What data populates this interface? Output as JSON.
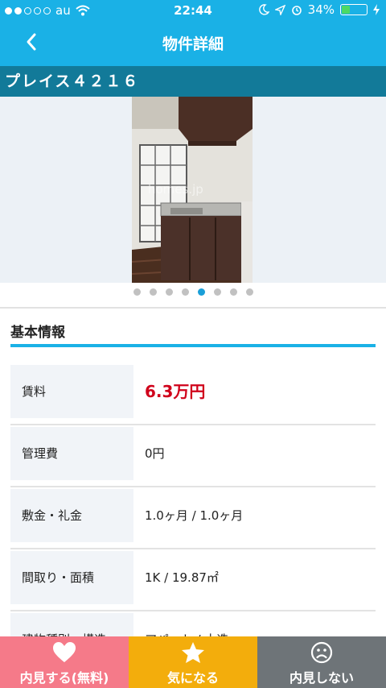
{
  "status_bar": {
    "carrier": "au",
    "time": "22:44",
    "battery": "34%",
    "battery_level": 0.34
  },
  "header": {
    "title": "物件詳細"
  },
  "property": {
    "name": "プレイス４２１６"
  },
  "gallery": {
    "watermark": "homes.jp",
    "page_count": 8,
    "active_index": 4
  },
  "section": {
    "title": "基本情報"
  },
  "details": [
    {
      "label": "賃料",
      "value": "6.3万円"
    },
    {
      "label": "管理費",
      "value": "0円"
    },
    {
      "label": "敷金・礼金",
      "value": "1.0ヶ月 / 1.0ヶ月"
    },
    {
      "label": "間取り・面積",
      "value": "1K / 19.87㎡"
    },
    {
      "label": "建物種別・構造",
      "value": "アパート / 木造"
    }
  ],
  "bottom_bar": {
    "visit": "内見する(無料)",
    "favorite": "気になる",
    "no_visit": "内見しない"
  },
  "colors": {
    "header": "#1ab1e6",
    "name_bar": "#127a99",
    "rent": "#d0021b",
    "visit": "#f57a89",
    "favorite": "#f3ad0c",
    "no_visit": "#6e7478"
  },
  "icons": {
    "back": "chevron-left-icon",
    "visit": "heart-icon",
    "favorite": "star-icon",
    "no_visit": "sad-face-icon"
  }
}
